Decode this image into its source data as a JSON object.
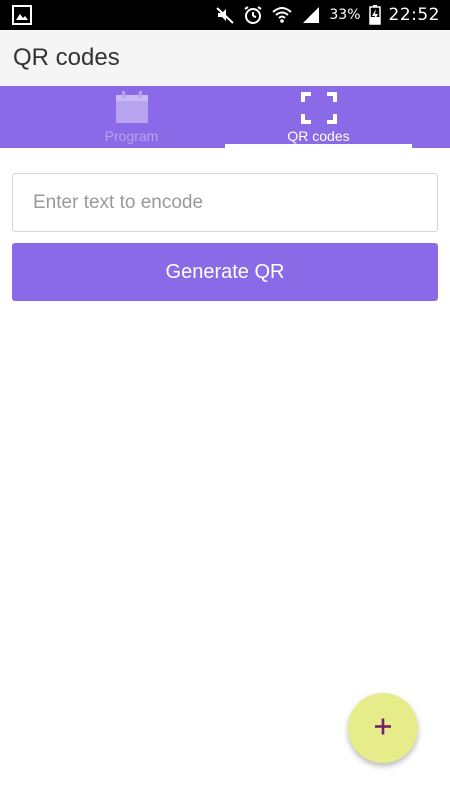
{
  "status_bar": {
    "left_icon": "image-icon",
    "icons": [
      "mute-icon",
      "alarm-icon",
      "wifi-icon",
      "signal-icon"
    ],
    "battery_percent": "33%",
    "battery_icon": "battery-charging-icon",
    "time": "22:52"
  },
  "app_bar": {
    "title": "QR codes"
  },
  "tabs": [
    {
      "label": "Program",
      "icon": "calendar-icon",
      "selected": false
    },
    {
      "label": "QR codes",
      "icon": "scan-frame-icon",
      "selected": true
    }
  ],
  "form": {
    "input_placeholder": "Enter text to encode",
    "input_value": "",
    "generate_label": "Generate QR"
  },
  "fab": {
    "icon": "plus-icon"
  },
  "colors": {
    "primary": "#8a6ae6",
    "fab": "#e6ec8a",
    "fab_icon": "#7a1f6e",
    "inactive_tab": "#b6a4ef"
  }
}
